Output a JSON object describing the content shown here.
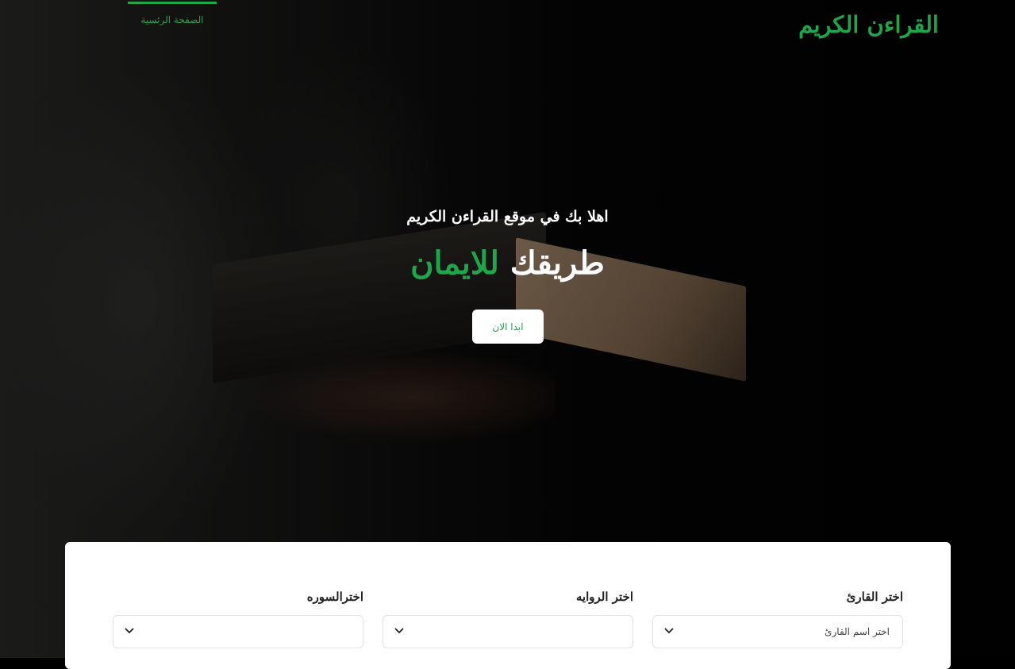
{
  "header": {
    "brand": "القراءن الكريم",
    "nav": [
      {
        "label": "الصفحة الرئسية",
        "active": true
      }
    ]
  },
  "hero": {
    "welcome": "اهلا بك في موقع القراءن الكريم",
    "tagline_part1": "طريقك",
    "tagline_part2": "للايمان",
    "start_button": "ابدا الان"
  },
  "selectors": {
    "reader": {
      "label": "اختر القارئ",
      "value": "اختر اسم القارئ"
    },
    "narration": {
      "label": "اختر الروايه",
      "value": ""
    },
    "surah": {
      "label": "اخترالسوره",
      "value": ""
    }
  },
  "colors": {
    "accent": "#1fa54a",
    "background": "#000000",
    "panel": "#ffffff"
  },
  "icons": {
    "dropdown": "chevron-down-icon"
  }
}
